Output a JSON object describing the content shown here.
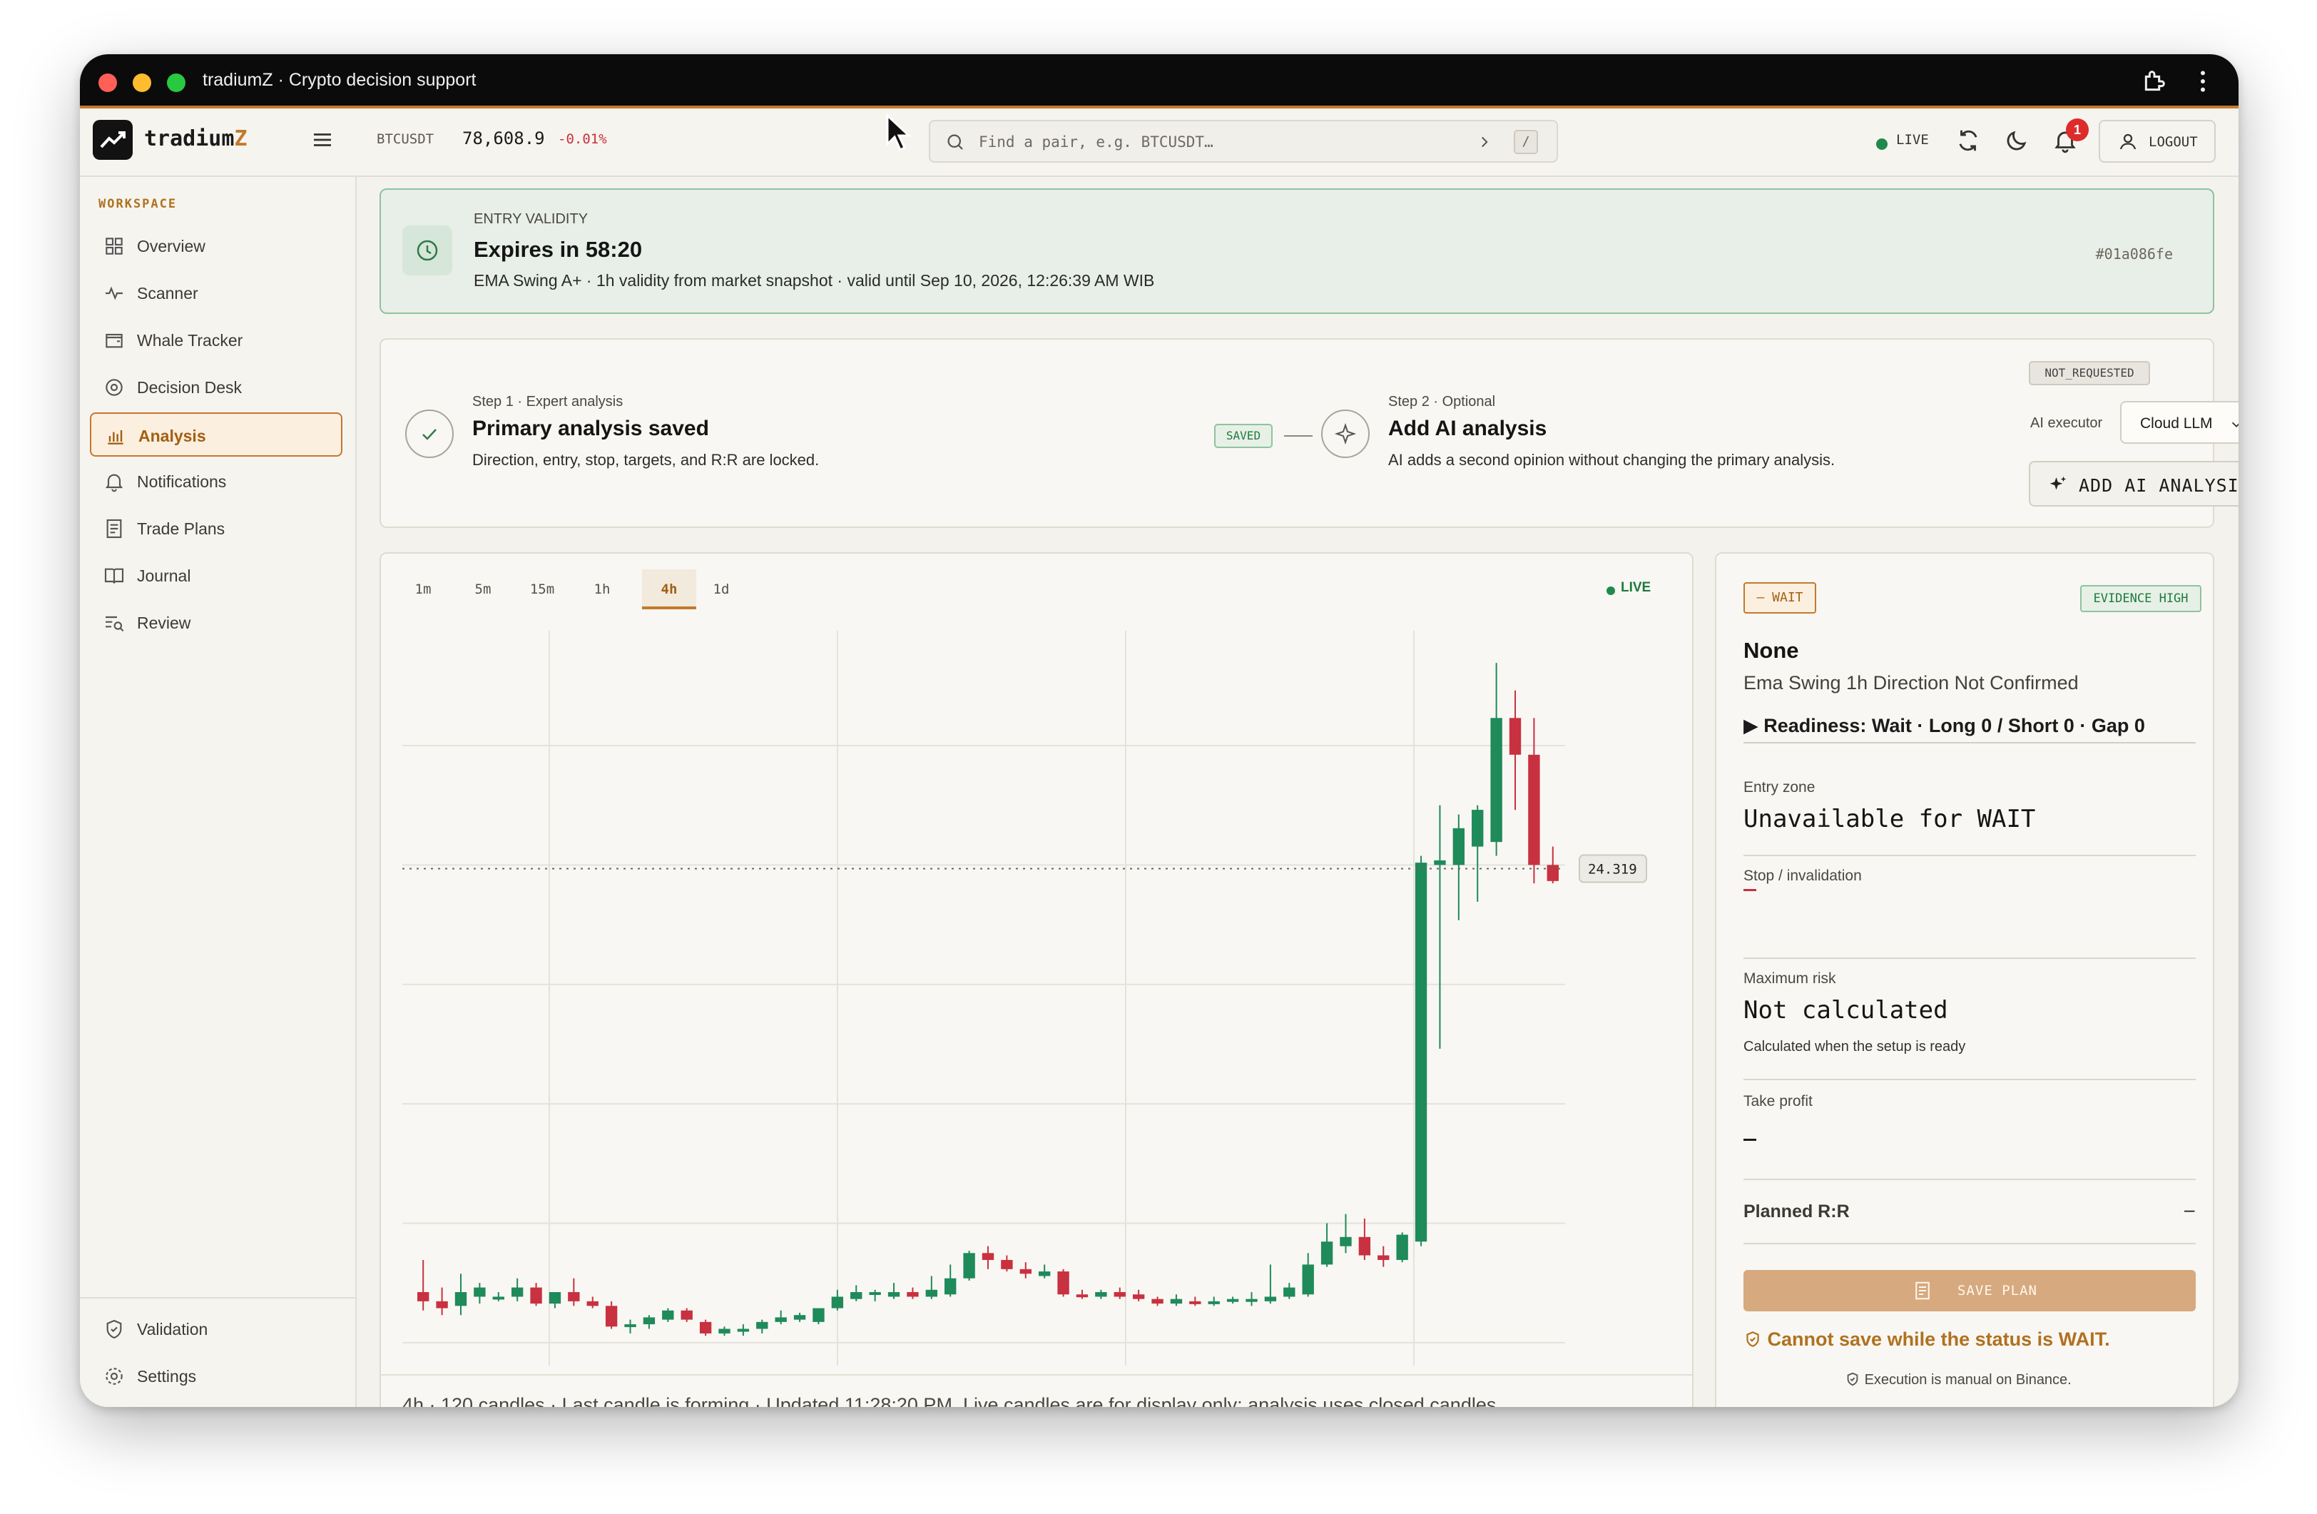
{
  "window": {
    "title": "tradiumZ · Crypto decision support"
  },
  "header": {
    "brand_main": "tradium",
    "brand_accent": "Z",
    "ticker_symbol": "BTCUSDT",
    "ticker_price": "78,608.9",
    "ticker_change": "-0.01%",
    "search_placeholder": "Find a pair, e.g. BTCUSDT…",
    "search_shortcut": "/",
    "live_label": "LIVE",
    "notification_count": "1",
    "logout_label": "LOGOUT"
  },
  "sidebar": {
    "section_label": "WORKSPACE",
    "items": [
      {
        "label": "Overview",
        "icon": "grid-icon"
      },
      {
        "label": "Scanner",
        "icon": "pulse-icon"
      },
      {
        "label": "Whale Tracker",
        "icon": "wallet-icon"
      },
      {
        "label": "Decision Desk",
        "icon": "target-icon"
      },
      {
        "label": "Analysis",
        "icon": "bar-chart-icon",
        "active": true
      },
      {
        "label": "Notifications",
        "icon": "bell-icon"
      },
      {
        "label": "Trade Plans",
        "icon": "document-icon"
      },
      {
        "label": "Journal",
        "icon": "book-icon"
      },
      {
        "label": "Review",
        "icon": "list-search-icon"
      }
    ],
    "footer_items": [
      {
        "label": "Validation",
        "icon": "shield-check-icon"
      },
      {
        "label": "Settings",
        "icon": "gear-icon"
      }
    ]
  },
  "validity": {
    "kicker": "ENTRY VALIDITY",
    "title": "Expires in 58:20",
    "subtitle": "EMA Swing A+ · 1h validity from market snapshot · valid until Sep 10, 2026, 12:26:39 AM WIB",
    "hash": "#01a086fe"
  },
  "steps": {
    "step1_kicker": "Step 1 · Expert analysis",
    "step1_title": "Primary analysis saved",
    "step1_sub": "Direction, entry, stop, targets, and R:R are locked.",
    "saved_badge": "SAVED",
    "step2_kicker": "Step 2 · Optional",
    "step2_title": "Add AI analysis",
    "step2_sub": "AI adds a second opinion without changing the primary analysis.",
    "status_badge": "NOT_REQUESTED",
    "ai_executor_label": "AI executor",
    "ai_executor_value": "Cloud LLM",
    "ai_button": "ADD AI ANALYSIS"
  },
  "chart_panel": {
    "timeframes": [
      "1m",
      "5m",
      "15m",
      "1h",
      "4h",
      "1d"
    ],
    "active_timeframe": "4h",
    "live_label": "LIVE",
    "footer": "4h · 120 candles · Last candle is forming · Updated 11:28:20 PM. Live candles are for display only; analysis uses closed candles.",
    "price_tag": "24.319"
  },
  "chart_data": {
    "type": "candlestick",
    "title": "",
    "xlabel": "",
    "ylabel": "",
    "last_price": 24.319,
    "grid": true,
    "up_color": "#1f8a5a",
    "down_color": "#c8313f",
    "candles": [
      {
        "o": 15.1,
        "h": 15.8,
        "l": 14.7,
        "c": 14.9
      },
      {
        "o": 14.9,
        "h": 15.2,
        "l": 14.6,
        "c": 14.75
      },
      {
        "o": 14.8,
        "h": 15.5,
        "l": 14.6,
        "c": 15.1
      },
      {
        "o": 15.0,
        "h": 15.3,
        "l": 14.85,
        "c": 15.2
      },
      {
        "o": 15.0,
        "h": 15.1,
        "l": 14.9,
        "c": 15.0
      },
      {
        "o": 15.0,
        "h": 15.4,
        "l": 14.9,
        "c": 15.2
      },
      {
        "o": 15.2,
        "h": 15.3,
        "l": 14.8,
        "c": 14.85
      },
      {
        "o": 14.85,
        "h": 15.1,
        "l": 14.75,
        "c": 15.1
      },
      {
        "o": 15.1,
        "h": 15.4,
        "l": 14.8,
        "c": 14.9
      },
      {
        "o": 14.9,
        "h": 15.0,
        "l": 14.75,
        "c": 14.8
      },
      {
        "o": 14.8,
        "h": 14.9,
        "l": 14.3,
        "c": 14.35
      },
      {
        "o": 14.35,
        "h": 14.5,
        "l": 14.2,
        "c": 14.4
      },
      {
        "o": 14.4,
        "h": 14.6,
        "l": 14.3,
        "c": 14.55
      },
      {
        "o": 14.5,
        "h": 14.75,
        "l": 14.45,
        "c": 14.7
      },
      {
        "o": 14.7,
        "h": 14.75,
        "l": 14.45,
        "c": 14.5
      },
      {
        "o": 14.45,
        "h": 14.5,
        "l": 14.15,
        "c": 14.2
      },
      {
        "o": 14.2,
        "h": 14.35,
        "l": 14.15,
        "c": 14.3
      },
      {
        "o": 14.25,
        "h": 14.4,
        "l": 14.15,
        "c": 14.3
      },
      {
        "o": 14.3,
        "h": 14.5,
        "l": 14.2,
        "c": 14.45
      },
      {
        "o": 14.45,
        "h": 14.7,
        "l": 14.4,
        "c": 14.55
      },
      {
        "o": 14.5,
        "h": 14.65,
        "l": 14.45,
        "c": 14.6
      },
      {
        "o": 14.45,
        "h": 14.75,
        "l": 14.4,
        "c": 14.75
      },
      {
        "o": 14.75,
        "h": 15.15,
        "l": 14.7,
        "c": 15.0
      },
      {
        "o": 14.95,
        "h": 15.25,
        "l": 14.9,
        "c": 15.1
      },
      {
        "o": 15.05,
        "h": 15.15,
        "l": 14.9,
        "c": 15.1
      },
      {
        "o": 15.0,
        "h": 15.3,
        "l": 14.95,
        "c": 15.1
      },
      {
        "o": 15.1,
        "h": 15.2,
        "l": 14.95,
        "c": 15.0
      },
      {
        "o": 15.0,
        "h": 15.45,
        "l": 14.95,
        "c": 15.15
      },
      {
        "o": 15.05,
        "h": 15.7,
        "l": 15.0,
        "c": 15.4
      },
      {
        "o": 15.4,
        "h": 16.0,
        "l": 15.35,
        "c": 15.95
      },
      {
        "o": 15.95,
        "h": 16.1,
        "l": 15.6,
        "c": 15.8
      },
      {
        "o": 15.8,
        "h": 15.9,
        "l": 15.55,
        "c": 15.6
      },
      {
        "o": 15.6,
        "h": 15.75,
        "l": 15.4,
        "c": 15.5
      },
      {
        "o": 15.45,
        "h": 15.7,
        "l": 15.4,
        "c": 15.55
      },
      {
        "o": 15.55,
        "h": 15.6,
        "l": 15.0,
        "c": 15.05
      },
      {
        "o": 15.05,
        "h": 15.15,
        "l": 14.95,
        "c": 15.0
      },
      {
        "o": 15.0,
        "h": 15.15,
        "l": 14.95,
        "c": 15.1
      },
      {
        "o": 15.1,
        "h": 15.2,
        "l": 14.95,
        "c": 15.0
      },
      {
        "o": 15.05,
        "h": 15.15,
        "l": 14.9,
        "c": 14.95
      },
      {
        "o": 14.95,
        "h": 15.0,
        "l": 14.8,
        "c": 14.85
      },
      {
        "o": 14.85,
        "h": 15.05,
        "l": 14.8,
        "c": 14.95
      },
      {
        "o": 14.9,
        "h": 15.0,
        "l": 14.8,
        "c": 14.85
      },
      {
        "o": 14.85,
        "h": 15.0,
        "l": 14.8,
        "c": 14.9
      },
      {
        "o": 14.9,
        "h": 15.0,
        "l": 14.85,
        "c": 14.95
      },
      {
        "o": 14.9,
        "h": 15.1,
        "l": 14.8,
        "c": 14.95
      },
      {
        "o": 14.9,
        "h": 15.7,
        "l": 14.85,
        "c": 15.0
      },
      {
        "o": 15.0,
        "h": 15.3,
        "l": 14.95,
        "c": 15.2
      },
      {
        "o": 15.05,
        "h": 15.95,
        "l": 15.0,
        "c": 15.7
      },
      {
        "o": 15.7,
        "h": 16.6,
        "l": 15.65,
        "c": 16.2
      },
      {
        "o": 16.1,
        "h": 16.8,
        "l": 15.95,
        "c": 16.3
      },
      {
        "o": 16.3,
        "h": 16.7,
        "l": 15.8,
        "c": 15.9
      },
      {
        "o": 15.9,
        "h": 16.1,
        "l": 15.65,
        "c": 15.8
      },
      {
        "o": 15.8,
        "h": 16.4,
        "l": 15.75,
        "c": 16.35
      },
      {
        "o": 16.2,
        "h": 24.6,
        "l": 16.1,
        "c": 24.45
      },
      {
        "o": 24.4,
        "h": 25.7,
        "l": 20.4,
        "c": 24.5
      },
      {
        "o": 24.4,
        "h": 25.5,
        "l": 23.2,
        "c": 25.2
      },
      {
        "o": 24.8,
        "h": 25.7,
        "l": 23.6,
        "c": 25.6
      },
      {
        "o": 24.9,
        "h": 28.8,
        "l": 24.6,
        "c": 27.6
      },
      {
        "o": 27.6,
        "h": 28.2,
        "l": 25.6,
        "c": 26.8
      },
      {
        "o": 26.8,
        "h": 27.6,
        "l": 24.0,
        "c": 24.4
      },
      {
        "o": 24.4,
        "h": 24.8,
        "l": 24.0,
        "c": 24.05
      }
    ]
  },
  "decision": {
    "status_badge": "– WAIT",
    "evidence_badge": "EVIDENCE HIGH",
    "direction": "None",
    "setup_note": "Ema Swing 1h Direction Not Confirmed",
    "readiness": "Readiness: Wait · Long 0 / Short 0 · Gap 0",
    "entry_label": "Entry zone",
    "entry_value": "Unavailable for WAIT",
    "stop_label": "Stop / invalidation",
    "risk_label": "Maximum risk",
    "risk_value": "Not calculated",
    "risk_note": "Calculated when the setup is ready",
    "tp_label": "Take profit",
    "rr_label": "Planned R:R",
    "rr_value": "–",
    "save_button": "SAVE PLAN",
    "warning": "Cannot save while the status is WAIT.",
    "exec_note": "Execution is manual on Binance."
  }
}
